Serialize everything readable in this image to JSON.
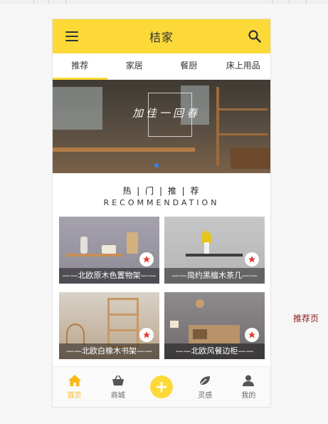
{
  "app": {
    "title": "桔家"
  },
  "tabs": [
    {
      "label": "推荐",
      "active": true
    },
    {
      "label": "家居"
    },
    {
      "label": "餐厨"
    },
    {
      "label": "床上用品"
    }
  ],
  "banner": {
    "calligraphy": "加佳一回春"
  },
  "section": {
    "title": "热 | 门 | 推 | 荐",
    "subtitle": "RECOMMENDATION"
  },
  "products": [
    {
      "caption": "——北欧原木色置物架——"
    },
    {
      "caption": "——简约黑檀木茶几——"
    },
    {
      "caption": "——北欧白橡木书架——"
    },
    {
      "caption": "——北欧风餐边柜——"
    }
  ],
  "bottom_nav": [
    {
      "label": "首页",
      "icon": "home-icon",
      "active": true
    },
    {
      "label": "商城",
      "icon": "basket-icon"
    },
    {
      "label": "",
      "icon": "plus-icon"
    },
    {
      "label": "灵感",
      "icon": "leaf-icon"
    },
    {
      "label": "我的",
      "icon": "user-icon"
    }
  ],
  "side_label": "推荐页",
  "colors": {
    "accent": "#fdd938",
    "active_text": "#f6b91b",
    "favorite": "#e03a2f"
  }
}
